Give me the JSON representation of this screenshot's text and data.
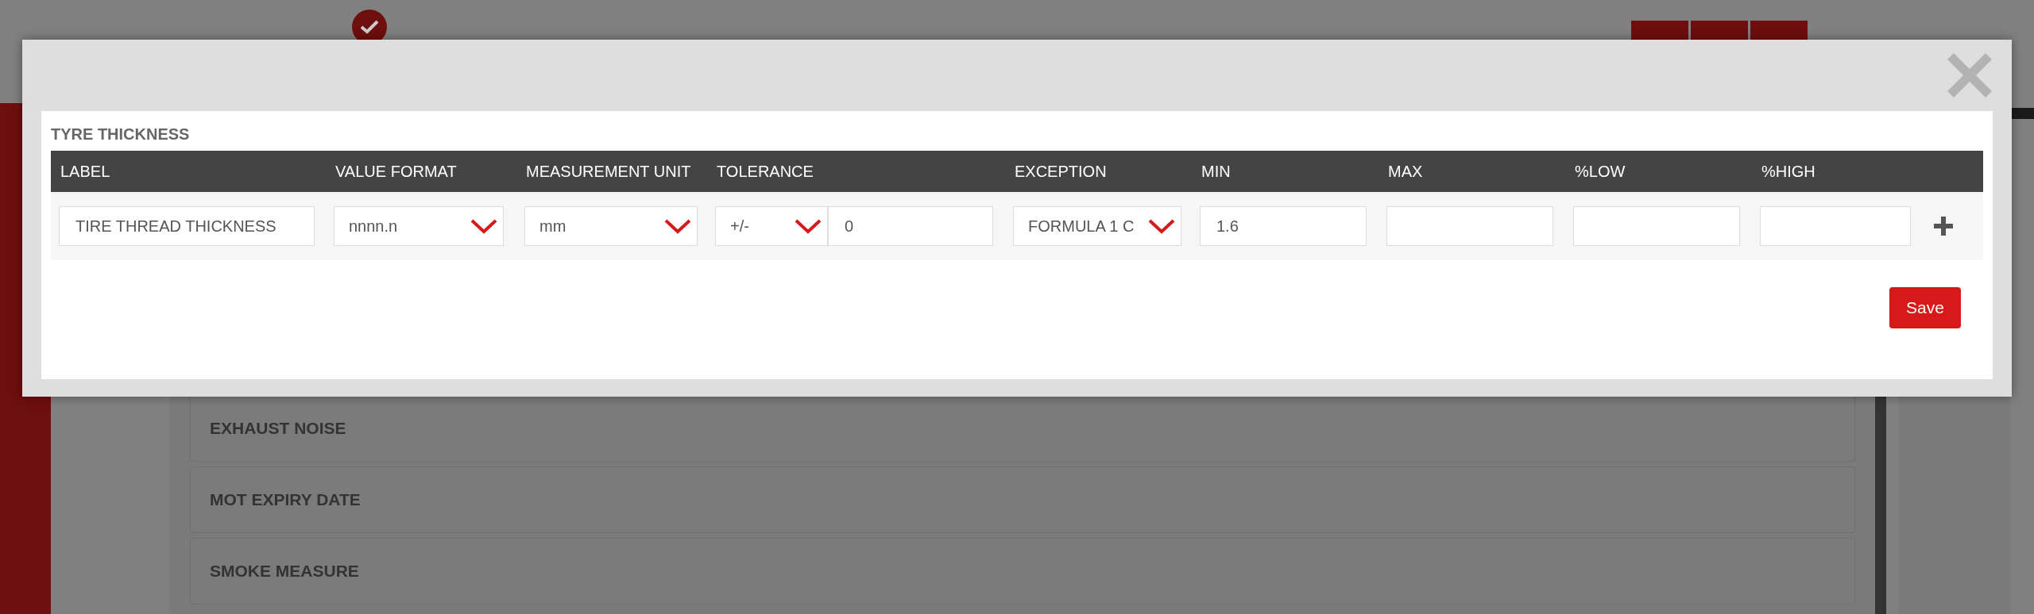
{
  "background": {
    "list_items": [
      "EXHAUST NOISE",
      "MOT EXPIRY DATE",
      "SMOKE MEASURE"
    ]
  },
  "modal": {
    "title": "TYRE THICKNESS",
    "columns": [
      {
        "label": "LABEL",
        "fields": [
          {
            "kind": "text",
            "value": "TIRE THREAD THICKNESS"
          }
        ]
      },
      {
        "label": "VALUE FORMAT",
        "fields": [
          {
            "kind": "select",
            "value": "nnnn.n"
          }
        ]
      },
      {
        "label": "MEASUREMENT UNIT",
        "fields": [
          {
            "kind": "select",
            "value": "mm"
          }
        ]
      },
      {
        "label": "TOLERANCE",
        "fields": [
          {
            "kind": "select",
            "value": "+/-"
          },
          {
            "kind": "text",
            "value": "0"
          }
        ]
      },
      {
        "label": "EXCEPTION",
        "fields": [
          {
            "kind": "select",
            "value": "FORMULA 1 C"
          }
        ]
      },
      {
        "label": "MIN",
        "fields": [
          {
            "kind": "text",
            "value": "1.6"
          }
        ]
      },
      {
        "label": "MAX",
        "fields": [
          {
            "kind": "text"
          }
        ]
      },
      {
        "label": "%LOW",
        "fields": [
          {
            "kind": "text"
          }
        ]
      },
      {
        "label": "%HIGH",
        "fields": [
          {
            "kind": "text"
          }
        ]
      }
    ],
    "save_button": "Save"
  }
}
